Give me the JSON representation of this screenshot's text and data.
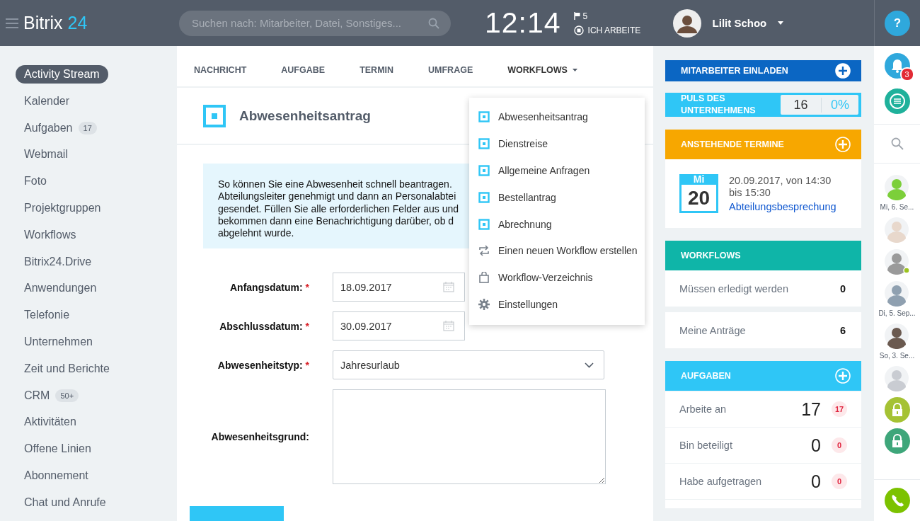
{
  "header": {
    "logo_text": "Bitrix",
    "logo_number": "24",
    "search_placeholder": "Suchen nach: Mitarbeiter, Datei, Sonstiges...",
    "clock": "12:14",
    "flag_count": "5",
    "work_status": "ICH ARBEITE",
    "user_name": "Lilit Schoo",
    "help": "?"
  },
  "sidebar": {
    "items": [
      {
        "label": "Activity Stream",
        "selected": true
      },
      {
        "label": "Kalender",
        "selected": false
      },
      {
        "label": "Aufgaben",
        "count": "17",
        "selected": false
      },
      {
        "label": "Webmail",
        "selected": false
      },
      {
        "label": "Foto",
        "selected": false
      },
      {
        "label": "Projektgruppen",
        "selected": false
      },
      {
        "label": "Workflows",
        "selected": false
      },
      {
        "label": "Bitrix24.Drive",
        "selected": false
      },
      {
        "label": "Anwendungen",
        "selected": false
      },
      {
        "label": "Telefonie",
        "selected": false
      },
      {
        "label": "Unternehmen",
        "selected": false
      },
      {
        "label": "Zeit und Berichte",
        "selected": false
      },
      {
        "label": "CRM",
        "count": "50+",
        "selected": false
      },
      {
        "label": "Aktivitäten",
        "selected": false
      },
      {
        "label": "Offene Linien",
        "selected": false
      },
      {
        "label": "Abonnement",
        "selected": false
      },
      {
        "label": "Chat und Anrufe",
        "selected": false
      }
    ]
  },
  "compose_tabs": [
    {
      "label": "NACHRICHT",
      "selected": false,
      "expanded": false
    },
    {
      "label": "AUFGABE",
      "selected": false,
      "expanded": false
    },
    {
      "label": "TERMIN",
      "selected": false,
      "expanded": false
    },
    {
      "label": "UMFRAGE",
      "selected": false,
      "expanded": false
    },
    {
      "label": "WORKFLOWS",
      "selected": false,
      "expanded": true,
      "has_menu": true
    }
  ],
  "form": {
    "title": "Abwesenheitsantrag",
    "description": [
      "So können Sie eine Abwesenheit schnell beantragen.",
      "Abteilungsleiter genehmigt und dann an Personalabtei",
      "gesendet. Füllen Sie alle erforderlichen Felder aus und",
      "bekommen dann eine Benachrichtigung darüber, ob d",
      "abgelehnt wurde."
    ],
    "fields": [
      {
        "kind": "date",
        "label": "Anfangsdatum:",
        "required_mark": "*",
        "value": "18.09.2017"
      },
      {
        "kind": "date",
        "label": "Abschlussdatum:",
        "required_mark": "*",
        "value": "30.09.2017"
      },
      {
        "kind": "select",
        "label": "Abwesenheitstyp:",
        "required_mark": "*",
        "value": "Jahresurlaub"
      },
      {
        "kind": "textarea",
        "label": "Abwesenheitsgrund:"
      }
    ],
    "actions": [
      {
        "kind": "primary"
      }
    ]
  },
  "workflow_menu": {
    "items": [
      {
        "kind": "process",
        "label": "Abwesenheitsantrag"
      },
      {
        "kind": "process",
        "label": "Dienstreise"
      },
      {
        "kind": "process",
        "label": "Allgemeine Anfragen"
      },
      {
        "kind": "process",
        "label": "Bestellantrag"
      },
      {
        "kind": "process",
        "label": "Abrechnung"
      },
      {
        "kind": "create",
        "label": "Einen neuen Workflow erstellen"
      },
      {
        "kind": "catalog",
        "label": "Workflow-Verzeichnis"
      },
      {
        "kind": "settings",
        "label": "Einstellungen"
      }
    ]
  },
  "widgets": {
    "invite": {
      "title": "MITARBEITER EINLADEN"
    },
    "pulse": {
      "title": "PULS DES UNTERNEHMENS",
      "count": "16",
      "percent": "0%"
    },
    "events": {
      "title": "ANSTEHENDE TERMINE",
      "day_name": "Mi",
      "day": "20",
      "when": "20.09.2017, von 14:30 bis 15:30",
      "event": "Abteilungsbesprechung"
    },
    "workflows": {
      "title": "WORKFLOWS",
      "rows": [
        {
          "label": "Müssen erledigt werden",
          "value": "0"
        },
        {
          "label": "Meine Anträge",
          "value": "6"
        }
      ]
    },
    "tasks": {
      "title": "AUFGABEN",
      "rows": [
        {
          "label": "Arbeite an",
          "value": "17",
          "counter": "17"
        },
        {
          "label": "Bin beteiligt",
          "value": "0",
          "counter": "0"
        },
        {
          "label": "Habe aufgetragen",
          "value": "0",
          "counter": "0"
        }
      ]
    }
  },
  "right_bar": {
    "notifications": "3",
    "recent": [
      {
        "kind": "avatar",
        "color": "#7ccf3a",
        "online": false
      },
      {
        "kind": "date",
        "label": "Mi, 6. Se..."
      },
      {
        "kind": "avatar",
        "color": "#e8d8cc",
        "online": false
      },
      {
        "kind": "avatar",
        "color": "#9a9a9a",
        "online": true
      },
      {
        "kind": "avatar",
        "color": "#8fa0b0",
        "online": false
      },
      {
        "kind": "date",
        "label": "Di, 5. Sep..."
      },
      {
        "kind": "avatar",
        "color": "#6b5a50",
        "online": false
      },
      {
        "kind": "date",
        "label": "So, 3. Se..."
      },
      {
        "kind": "avatar",
        "color": "#c9ccd2",
        "online": false
      },
      {
        "kind": "lock",
        "color": "#a5c234"
      },
      {
        "kind": "lock",
        "color": "#3ea67a"
      }
    ]
  }
}
